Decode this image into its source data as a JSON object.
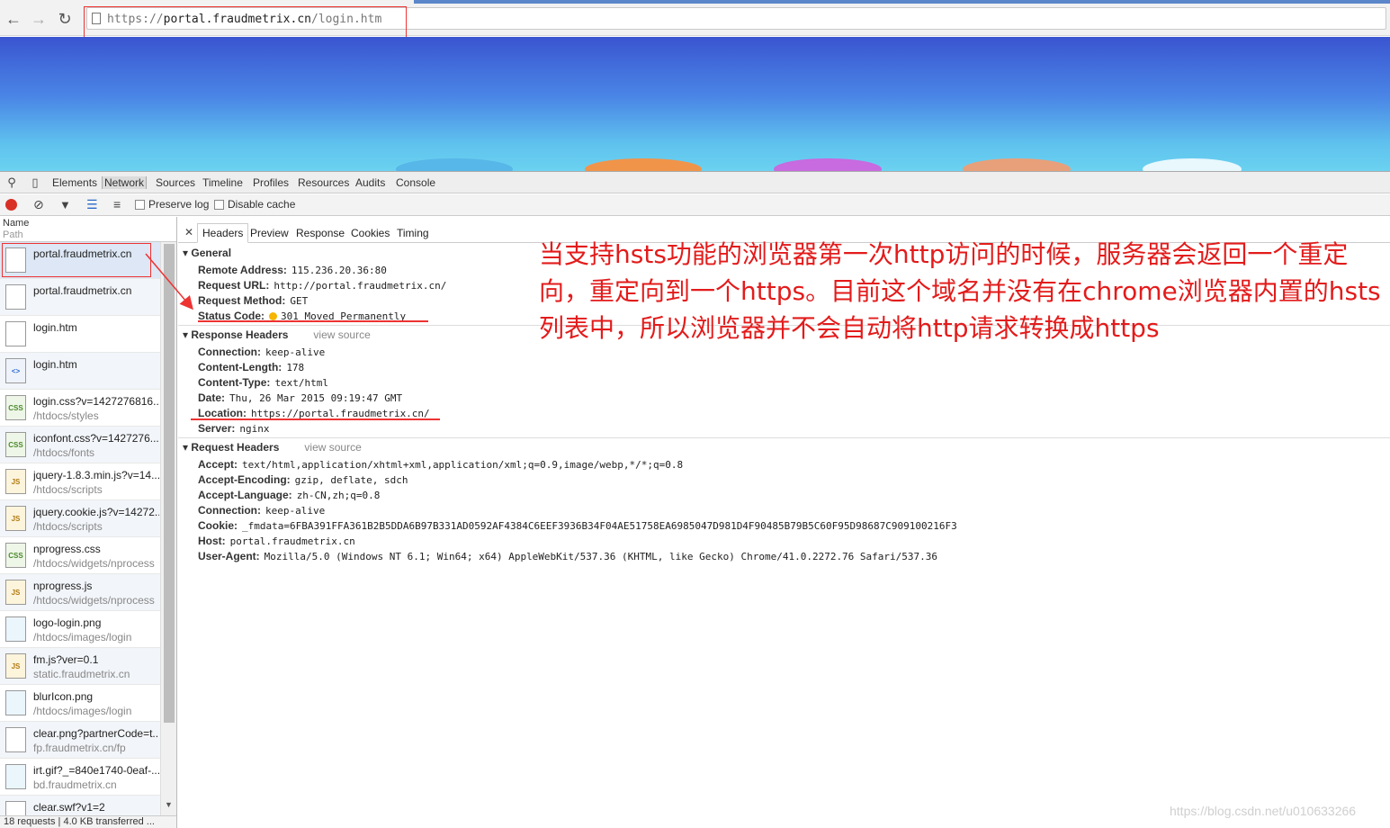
{
  "browser": {
    "url_scheme": "https://",
    "url_host": "portal.fraudmetrix.cn",
    "url_path": "/login.htm"
  },
  "devtools": {
    "tabs": [
      "Elements",
      "Network",
      "Sources",
      "Timeline",
      "Profiles",
      "Resources",
      "Audits",
      "Console"
    ],
    "active_tab": "Network",
    "network_toolbar": {
      "preserve_log": "Preserve log",
      "disable_cache": "Disable cache"
    },
    "columns": {
      "name": "Name",
      "path": "Path"
    },
    "requests": [
      {
        "name": "portal.fraudmetrix.cn",
        "path": "",
        "type": "doc-blank"
      },
      {
        "name": "portal.fraudmetrix.cn",
        "path": "",
        "type": "doc-blank"
      },
      {
        "name": "login.htm",
        "path": "",
        "type": "doc-blank"
      },
      {
        "name": "login.htm",
        "path": "",
        "type": "doc"
      },
      {
        "name": "login.css?v=1427276816...",
        "path": "/htdocs/styles",
        "type": "css"
      },
      {
        "name": "iconfont.css?v=1427276...",
        "path": "/htdocs/fonts",
        "type": "css"
      },
      {
        "name": "jquery-1.8.3.min.js?v=14...",
        "path": "/htdocs/scripts",
        "type": "js"
      },
      {
        "name": "jquery.cookie.js?v=14272...",
        "path": "/htdocs/scripts",
        "type": "js"
      },
      {
        "name": "nprogress.css",
        "path": "/htdocs/widgets/nprocess",
        "type": "css"
      },
      {
        "name": "nprogress.js",
        "path": "/htdocs/widgets/nprocess",
        "type": "js"
      },
      {
        "name": "logo-login.png",
        "path": "/htdocs/images/login",
        "type": "img"
      },
      {
        "name": "fm.js?ver=0.1",
        "path": "static.fraudmetrix.cn",
        "type": "js"
      },
      {
        "name": "blurIcon.png",
        "path": "/htdocs/images/login",
        "type": "img"
      },
      {
        "name": "clear.png?partnerCode=t...",
        "path": "fp.fraudmetrix.cn/fp",
        "type": "doc-blank"
      },
      {
        "name": "irt.gif?_=840e1740-0eaf-...",
        "path": "bd.fraudmetrix.cn",
        "type": "img"
      },
      {
        "name": "clear.swf?v1=2",
        "path": "",
        "type": "doc-blank"
      }
    ],
    "footer": "18 requests | 4.0 KB transferred ...",
    "detail_tabs": [
      "Headers",
      "Preview",
      "Response",
      "Cookies",
      "Timing"
    ],
    "active_detail_tab": "Headers",
    "general": {
      "title": "General",
      "rows": [
        {
          "k": "Remote Address:",
          "v": "115.236.20.36:80"
        },
        {
          "k": "Request URL:",
          "v": "http://portal.fraudmetrix.cn/"
        },
        {
          "k": "Request Method:",
          "v": "GET"
        },
        {
          "k": "Status Code:",
          "v": "301 Moved Permanently"
        }
      ]
    },
    "response_headers": {
      "title": "Response Headers",
      "view_source": "view source",
      "rows": [
        {
          "k": "Connection:",
          "v": "keep-alive"
        },
        {
          "k": "Content-Length:",
          "v": "178"
        },
        {
          "k": "Content-Type:",
          "v": "text/html"
        },
        {
          "k": "Date:",
          "v": "Thu, 26 Mar 2015 09:19:47 GMT"
        },
        {
          "k": "Location:",
          "v": "https://portal.fraudmetrix.cn/"
        },
        {
          "k": "Server:",
          "v": "nginx"
        }
      ]
    },
    "request_headers": {
      "title": "Request Headers",
      "view_source": "view source",
      "rows": [
        {
          "k": "Accept:",
          "v": "text/html,application/xhtml+xml,application/xml;q=0.9,image/webp,*/*;q=0.8"
        },
        {
          "k": "Accept-Encoding:",
          "v": "gzip, deflate, sdch"
        },
        {
          "k": "Accept-Language:",
          "v": "zh-CN,zh;q=0.8"
        },
        {
          "k": "Connection:",
          "v": "keep-alive"
        },
        {
          "k": "Cookie:",
          "v": "_fmdata=6FBA391FFA361B2B5DDA6B97B331AD0592AF4384C6EEF3936B34F04AE51758EA6985047D981D4F90485B79B5C60F95D98687C909100216F3"
        },
        {
          "k": "Host:",
          "v": "portal.fraudmetrix.cn"
        },
        {
          "k": "User-Agent:",
          "v": "Mozilla/5.0 (Windows NT 6.1; Win64; x64) AppleWebKit/537.36 (KHTML, like Gecko) Chrome/41.0.2272.76 Safari/537.36"
        }
      ]
    }
  },
  "annotation": "当支持hsts功能的浏览器第一次http访问的时候，服务器会返回一个重定向，重定向到一个https。目前这个域名并没有在chrome浏览器内置的hsts列表中，所以浏览器并不会自动将http请求转换成https",
  "watermark": "https://blog.csdn.net/u010633266",
  "colors": {
    "annotation_red": "#e31b1b",
    "status_yellow": "#f6b500",
    "record_red": "#d93025"
  }
}
